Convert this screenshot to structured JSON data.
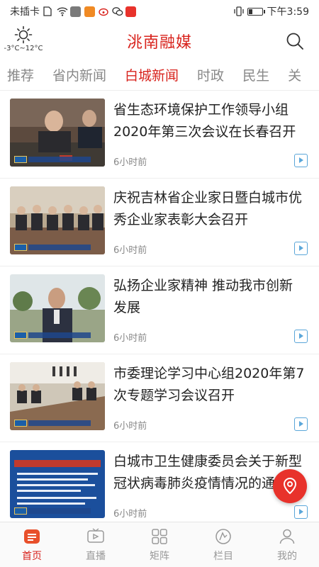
{
  "status_bar": {
    "carrier": "未插卡",
    "time": "下午3:59"
  },
  "header": {
    "app_title": "洮南融媒",
    "weather_temp": "-3°C~12°C"
  },
  "tabs": [
    {
      "label": "推荐"
    },
    {
      "label": "省内新闻"
    },
    {
      "label": "白城新闻",
      "active": true
    },
    {
      "label": "时政"
    },
    {
      "label": "民生"
    },
    {
      "label": "关"
    }
  ],
  "news": [
    {
      "title": "省生态环境保护工作领导小组2020年第三次会议在长春召开",
      "time": "6小时前"
    },
    {
      "title": "庆祝吉林省企业家日暨白城市优秀企业家表彰大会召开",
      "time": "6小时前"
    },
    {
      "title": "弘扬企业家精神 推动我市创新发展",
      "time": "6小时前"
    },
    {
      "title": "市委理论学习中心组2020年第7次专题学习会议召开",
      "time": "6小时前"
    },
    {
      "title": "白城市卫生健康委员会关于新型冠状病毒肺炎疫情情况的通报",
      "time": "6小时前"
    }
  ],
  "bottom_nav": [
    {
      "label": "首页",
      "icon": "home-icon",
      "active": true
    },
    {
      "label": "直播",
      "icon": "live-icon"
    },
    {
      "label": "矩阵",
      "icon": "matrix-icon"
    },
    {
      "label": "栏目",
      "icon": "column-icon"
    },
    {
      "label": "我的",
      "icon": "profile-icon"
    }
  ],
  "colors": {
    "brand": "#d8231d",
    "play": "#5aa6d9",
    "fab": "#e8322b"
  }
}
